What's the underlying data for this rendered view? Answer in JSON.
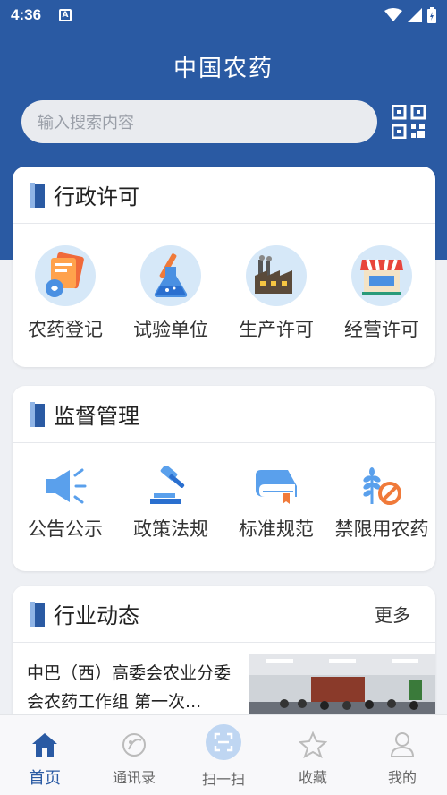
{
  "status": {
    "time": "4:36",
    "badge": "A"
  },
  "header": {
    "title": "中国农药",
    "search_placeholder": "输入搜索内容"
  },
  "sections": [
    {
      "title": "行政许可",
      "items": [
        "农药登记",
        "试验单位",
        "生产许可",
        "经营许可"
      ]
    },
    {
      "title": "监督管理",
      "items": [
        "公告公示",
        "政策法规",
        "标准规范",
        "禁限用农药"
      ]
    },
    {
      "title": "行业动态",
      "more": "更多",
      "news": "中巴（西）高委会农业分委会农药工作组 第一次..."
    }
  ],
  "tabs": [
    "首页",
    "通讯录",
    "扫一扫",
    "收藏",
    "我的"
  ],
  "colors": {
    "primary": "#2a5aa3",
    "accent_blue": "#4a90e2",
    "icon_bg": "#d6e8f8"
  }
}
